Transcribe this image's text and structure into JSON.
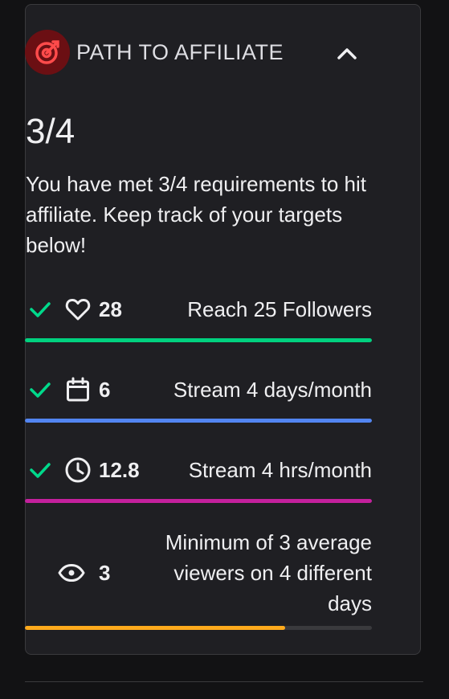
{
  "panel": {
    "title": "PATH TO AFFILIATE",
    "badge_icon": "target-icon",
    "collapse_icon": "chevron-up-icon",
    "progress_count": "3/4",
    "summary": "You have met 3/4 requirements to hit affiliate. Keep track of your targets below!"
  },
  "colors": {
    "badge_bg": "#6b0f13",
    "badge_icon": "#ff4b4b",
    "check": "#00d98b",
    "track": "#3a3a3d"
  },
  "requirements": [
    {
      "icon": "heart-icon",
      "value": "28",
      "label": "Reach 25 Followers",
      "met": true,
      "progress": 1.0,
      "color": "#00d17f"
    },
    {
      "icon": "calendar-icon",
      "value": "6",
      "label": "Stream 4 days/month",
      "met": true,
      "progress": 1.0,
      "color": "#5285f1"
    },
    {
      "icon": "clock-icon",
      "value": "12.8",
      "label": "Stream 4 hrs/month",
      "met": true,
      "progress": 1.0,
      "color": "#c4209d"
    },
    {
      "icon": "eye-icon",
      "value": "3",
      "label": "Minimum of 3 average viewers on 4 different days",
      "met": false,
      "progress": 0.75,
      "color": "#ffaa1c"
    }
  ]
}
